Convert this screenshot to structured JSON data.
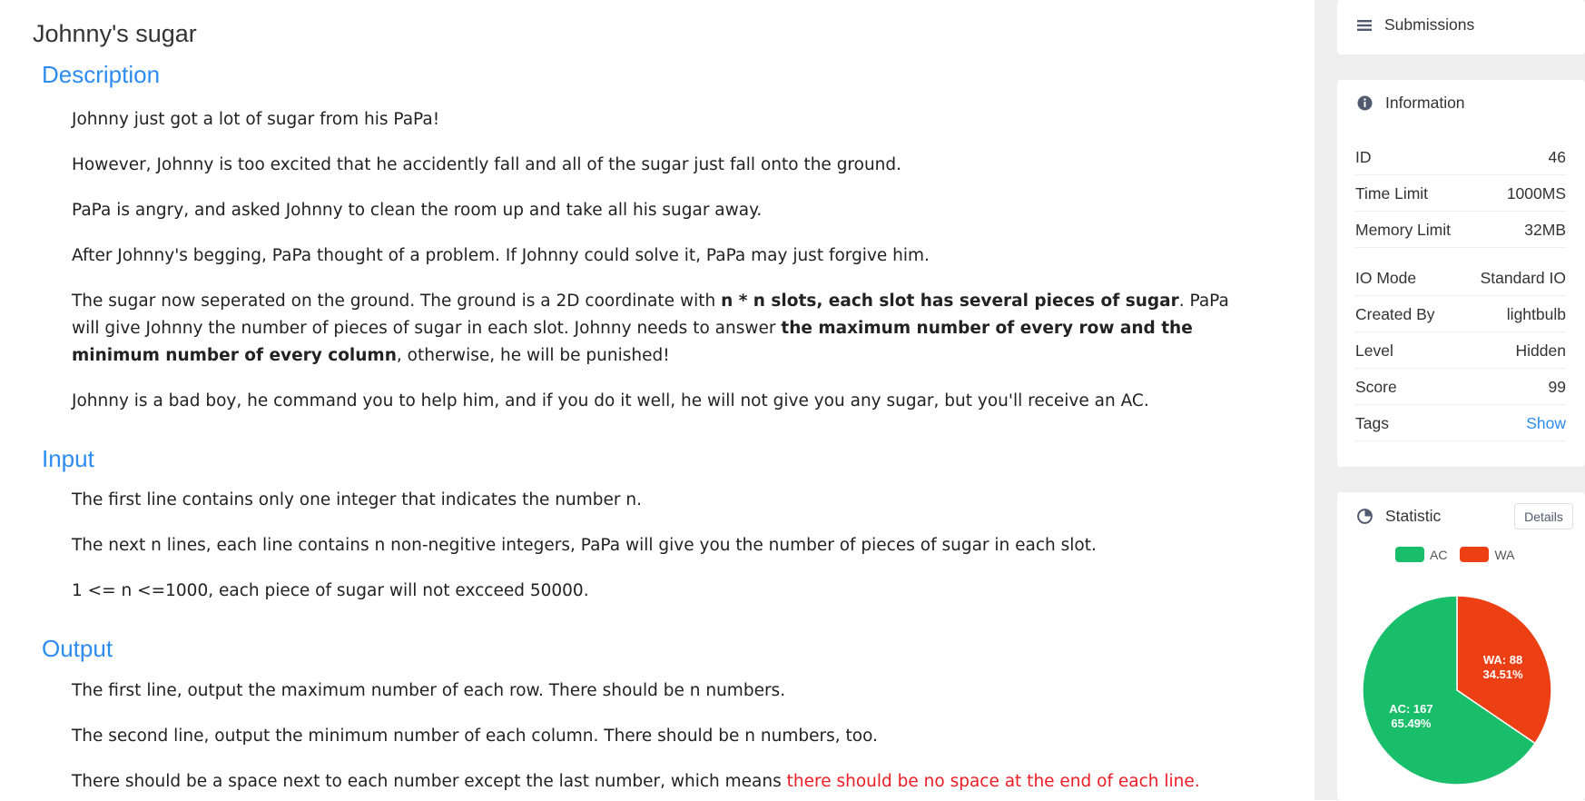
{
  "problem": {
    "title": "Johnny's sugar",
    "description_heading": "Description",
    "description": {
      "p1": "Johnny just got a lot of sugar from his PaPa!",
      "p2": "However, Johnny is too excited that he accidently fall and all of the sugar just fall onto the ground.",
      "p3": "PaPa is angry, and asked Johnny to clean the room up and take all his sugar away.",
      "p4": "After Johnny's begging, PaPa thought of a problem. If Johnny could solve it, PaPa may just forgive him.",
      "p5_a": "The sugar now seperated on the ground. The ground is a 2D coordinate with ",
      "p5_b": "n * n slots, each slot has several pieces of sugar",
      "p5_c": ". PaPa will give Johnny the number of pieces of sugar in each slot. Johnny needs to answer ",
      "p5_d": "the maximum number of every row and the minimum number of every column",
      "p5_e": ", otherwise, he will be punished!",
      "p6": "Johnny is a bad boy, he command you to help him, and if you do it well, he will not give you any sugar, but you'll receive an AC."
    },
    "input_heading": "Input",
    "input": {
      "p1": "The first line contains only one integer that indicates the number n.",
      "p2": "The next n lines, each line contains n non-negitive integers, PaPa will give you the number of pieces of sugar in each slot.",
      "p3": "1 <= n <=1000, each piece of sugar will not excceed 50000."
    },
    "output_heading": "Output",
    "output": {
      "p1": "The first line, output the maximum number of each row. There should be n numbers.",
      "p2": "The second line, output the minimum number of each column. There should be n numbers, too.",
      "p3_a": "There should be a space next to each number except the last number, which means ",
      "p3_b": "there should be no space at the end of each line."
    }
  },
  "sidebar": {
    "submissions_label": "Submissions",
    "information": {
      "heading": "Information",
      "rows": [
        {
          "label": "ID",
          "value": "46"
        },
        {
          "label": "Time Limit",
          "value": "1000MS"
        },
        {
          "label": "Memory Limit",
          "value": "32MB"
        },
        {
          "label": "IO Mode",
          "value": "Standard IO"
        },
        {
          "label": "Created By",
          "value": "lightbulb"
        },
        {
          "label": "Level",
          "value": "Hidden"
        },
        {
          "label": "Score",
          "value": "99"
        },
        {
          "label": "Tags",
          "value": "Show"
        }
      ]
    },
    "statistic": {
      "heading": "Statistic",
      "details_label": "Details"
    }
  },
  "chart_data": {
    "type": "pie",
    "series": [
      {
        "name": "AC",
        "value": 167,
        "percent_label": "65.49%",
        "label": "AC: 167",
        "color": "#19be6b"
      },
      {
        "name": "WA",
        "value": 88,
        "percent_label": "34.51%",
        "label": "WA: 88",
        "color": "#ed3f14"
      }
    ],
    "legend": "top"
  }
}
